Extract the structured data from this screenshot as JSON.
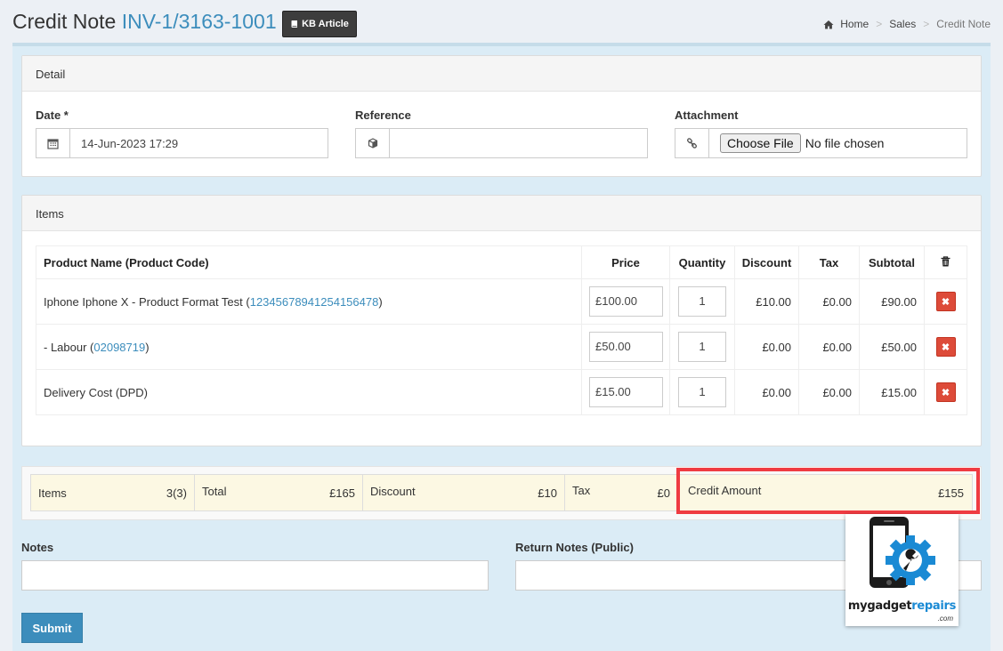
{
  "header": {
    "title": "Credit Note",
    "reference": "INV-1/3163-1001",
    "kb_button": "KB Article",
    "breadcrumb": {
      "home": "Home",
      "sales": "Sales",
      "current": "Credit Note"
    }
  },
  "detail": {
    "heading": "Detail",
    "date_label": "Date *",
    "date_value": "14-Jun-2023 17:29",
    "reference_label": "Reference",
    "reference_value": "",
    "attachment_label": "Attachment",
    "choose_file": "Choose File",
    "no_file": "No file chosen"
  },
  "items_panel": {
    "heading": "Items",
    "columns": [
      "Product Name (Product Code)",
      "Price",
      "Quantity",
      "Discount",
      "Tax",
      "Subtotal"
    ],
    "rows": [
      {
        "name": "Iphone Iphone X - Product Format Test (",
        "code": "12345678941254156478",
        "close": ")",
        "price": "£100.00",
        "qty": "1",
        "discount": "£10.00",
        "tax": "£0.00",
        "subtotal": "£90.00"
      },
      {
        "name": "- Labour (",
        "code": "02098719",
        "close": ")",
        "price": "£50.00",
        "qty": "1",
        "discount": "£0.00",
        "tax": "£0.00",
        "subtotal": "£50.00"
      },
      {
        "name": "Delivery Cost (DPD)",
        "code": "",
        "close": "",
        "price": "£15.00",
        "qty": "1",
        "discount": "£0.00",
        "tax": "£0.00",
        "subtotal": "£15.00"
      }
    ]
  },
  "totals": {
    "items_label": "Items",
    "items_value": "3(3)",
    "total_label": "Total",
    "total_value": "£165",
    "discount_label": "Discount",
    "discount_value": "£10",
    "tax_label": "Tax",
    "tax_value": "£0",
    "credit_label": "Credit Amount",
    "credit_value": "£155"
  },
  "notes": {
    "notes_label": "Notes",
    "return_notes_label": "Return Notes (Public)"
  },
  "submit": "Submit",
  "logo": {
    "text_a": "mygadget",
    "text_b": "repairs",
    "sub": ".com"
  },
  "colors": {
    "link": "#3c8dbc",
    "danger": "#dd4b39",
    "highlight": "#ef3b42",
    "totals_bg": "#fcf8e3"
  },
  "icons": [
    "home-icon",
    "book-icon",
    "calendar-icon",
    "cube-icon",
    "link-icon",
    "trash-icon",
    "remove-icon"
  ]
}
